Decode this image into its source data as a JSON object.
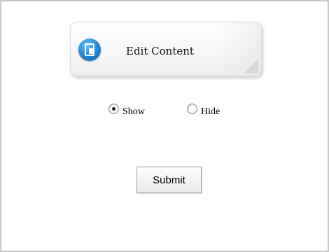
{
  "header": {
    "icon": "edit-content-icon",
    "title": "Edit Content"
  },
  "visibility": {
    "options": [
      {
        "label": "Show",
        "selected": true
      },
      {
        "label": "Hide",
        "selected": false
      }
    ]
  },
  "actions": {
    "submit_label": "Submit"
  },
  "colors": {
    "icon_blue": "#2a8fd4",
    "frame_border": "#c8c8c8"
  }
}
